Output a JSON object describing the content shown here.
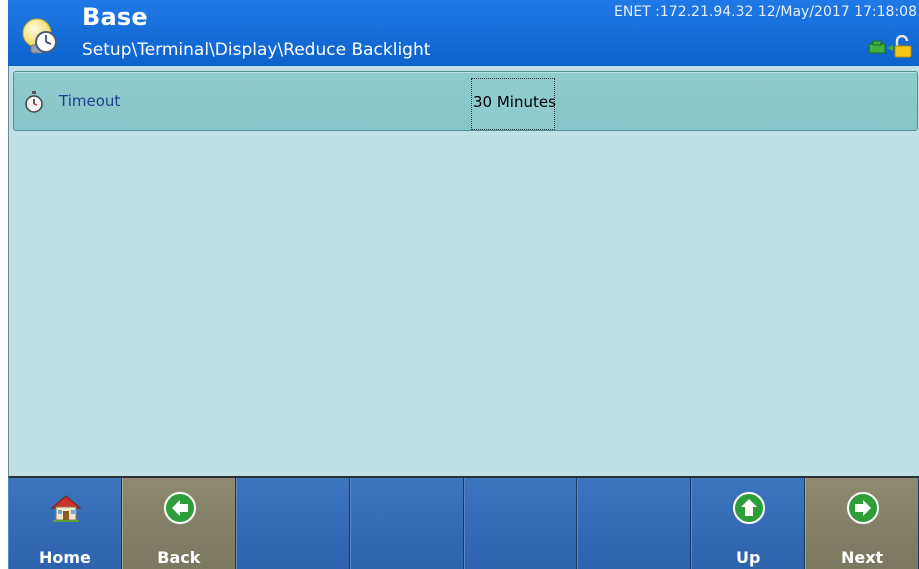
{
  "header": {
    "title": "Base",
    "path": "Setup\\Terminal\\Display\\Reduce Backlight",
    "status": "ENET :172.21.94.32 12/May/2017 17:18:08",
    "icon": "lightbulb-clock-icon",
    "lock_icon": "scale-unlocked-icon"
  },
  "settings": [
    {
      "label": "Timeout",
      "value": "30 Minutes",
      "icon": "stopwatch-icon"
    }
  ],
  "softkeys": [
    {
      "label": "Home",
      "icon": "home-icon"
    },
    {
      "label": "Back",
      "icon": "arrow-left-icon"
    },
    {
      "label": ""
    },
    {
      "label": ""
    },
    {
      "label": ""
    },
    {
      "label": ""
    },
    {
      "label": "Up",
      "icon": "arrow-up-icon"
    },
    {
      "label": "Next",
      "icon": "arrow-right-icon"
    }
  ],
  "colors": {
    "header_blue": "#1570dc",
    "content_bg": "#bfe1e3",
    "row_bg": "#8fcccf",
    "softkey_blue": "#3468b2",
    "softkey_olive": "#858269",
    "arrow_green": "#2e9e3a"
  }
}
